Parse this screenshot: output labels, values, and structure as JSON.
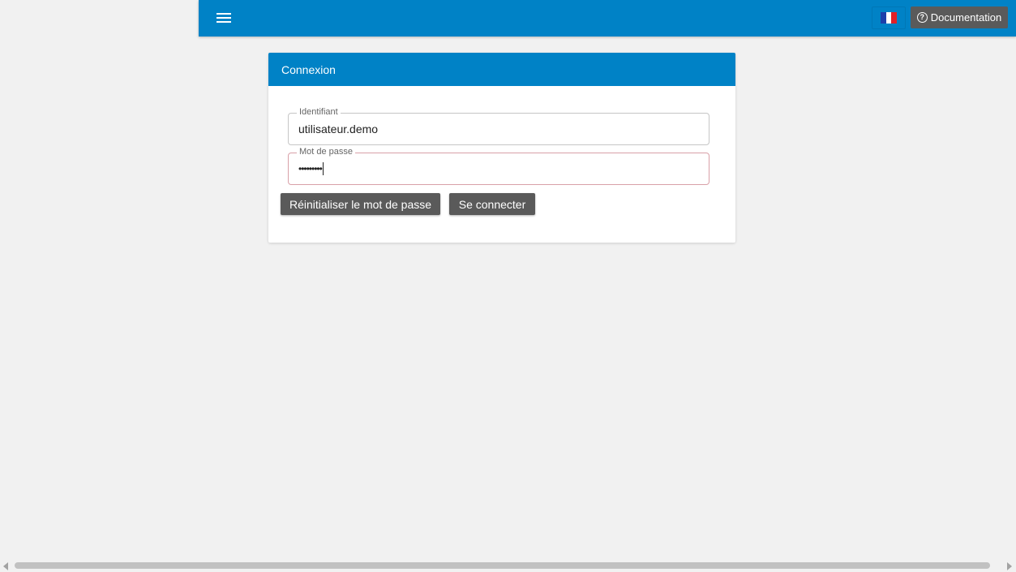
{
  "header": {
    "menu_icon": "hamburger-menu-icon",
    "language_flag": "france-flag-icon",
    "documentation_icon": "help-circle-icon",
    "documentation_label": "Documentation",
    "colors": {
      "bar": "#0082c6",
      "button": "#5a5a5a"
    }
  },
  "login_card": {
    "title": "Connexion",
    "username": {
      "label": "Identifiant",
      "value": "utilisateur.demo"
    },
    "password": {
      "label": "Mot de passe",
      "masked_value": "•••••••••"
    },
    "reset_button": "Réinitialiser le mot de passe",
    "login_button": "Se connecter"
  }
}
